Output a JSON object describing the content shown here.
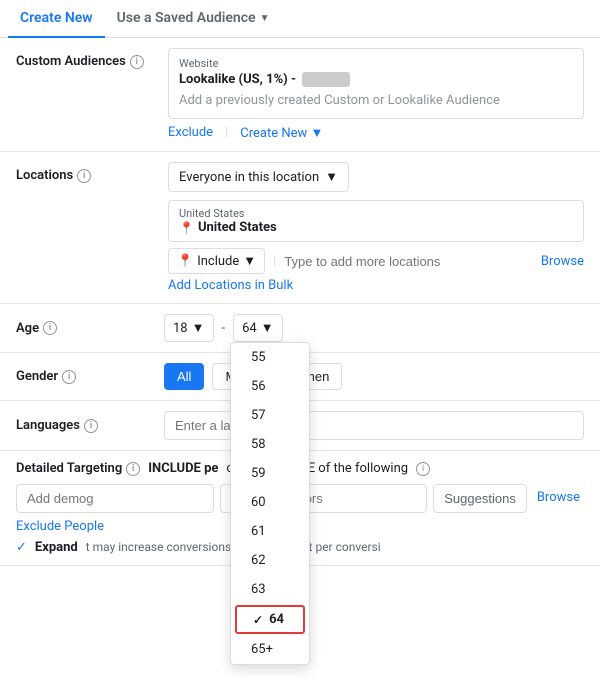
{
  "tabs": {
    "create_new": "Create New",
    "use_saved": "Use a Saved Audience"
  },
  "sections": {
    "custom_audiences": {
      "label": "Custom Audiences",
      "website_label": "Website",
      "audience_name": "Lookalike (US, 1%) -",
      "audience_blurred": "■■■■■■■",
      "placeholder": "Add a previously created Custom or Lookalike Audience",
      "exclude_link": "Exclude",
      "create_new_link": "Create New"
    },
    "locations": {
      "label": "Locations",
      "dropdown_text": "Everyone in this location",
      "country_label": "United States",
      "country_name": "United States",
      "include_label": "Include",
      "location_placeholder": "Type to add more locations",
      "browse_label": "Browse",
      "add_bulk_label": "Add Locations in Bulk"
    },
    "age": {
      "label": "Age",
      "min_age": "18",
      "max_age": "64",
      "dropdown_items": [
        "55",
        "56",
        "57",
        "58",
        "59",
        "60",
        "61",
        "62",
        "63",
        "64",
        "65+"
      ],
      "selected_value": "64"
    },
    "gender": {
      "label": "Gender",
      "buttons": [
        "All",
        "Men",
        "Women"
      ],
      "active": "All"
    },
    "languages": {
      "label": "Languages",
      "placeholder": "Enter a language"
    },
    "detailed_targeting": {
      "label": "Detailed Targeting",
      "include_prefix": "INCLUDE pe",
      "or_text": "ch at least ONE of the following",
      "demo_placeholder": "Add demog",
      "behaviors_placeholder": "sts or behaviors",
      "suggestions_label": "Suggestions",
      "browse_label": "Browse",
      "exclude_label": "Exclude People",
      "expand_label": "Expand",
      "expand_desc": "t may increase conversions at a lower cost per conversi"
    }
  }
}
